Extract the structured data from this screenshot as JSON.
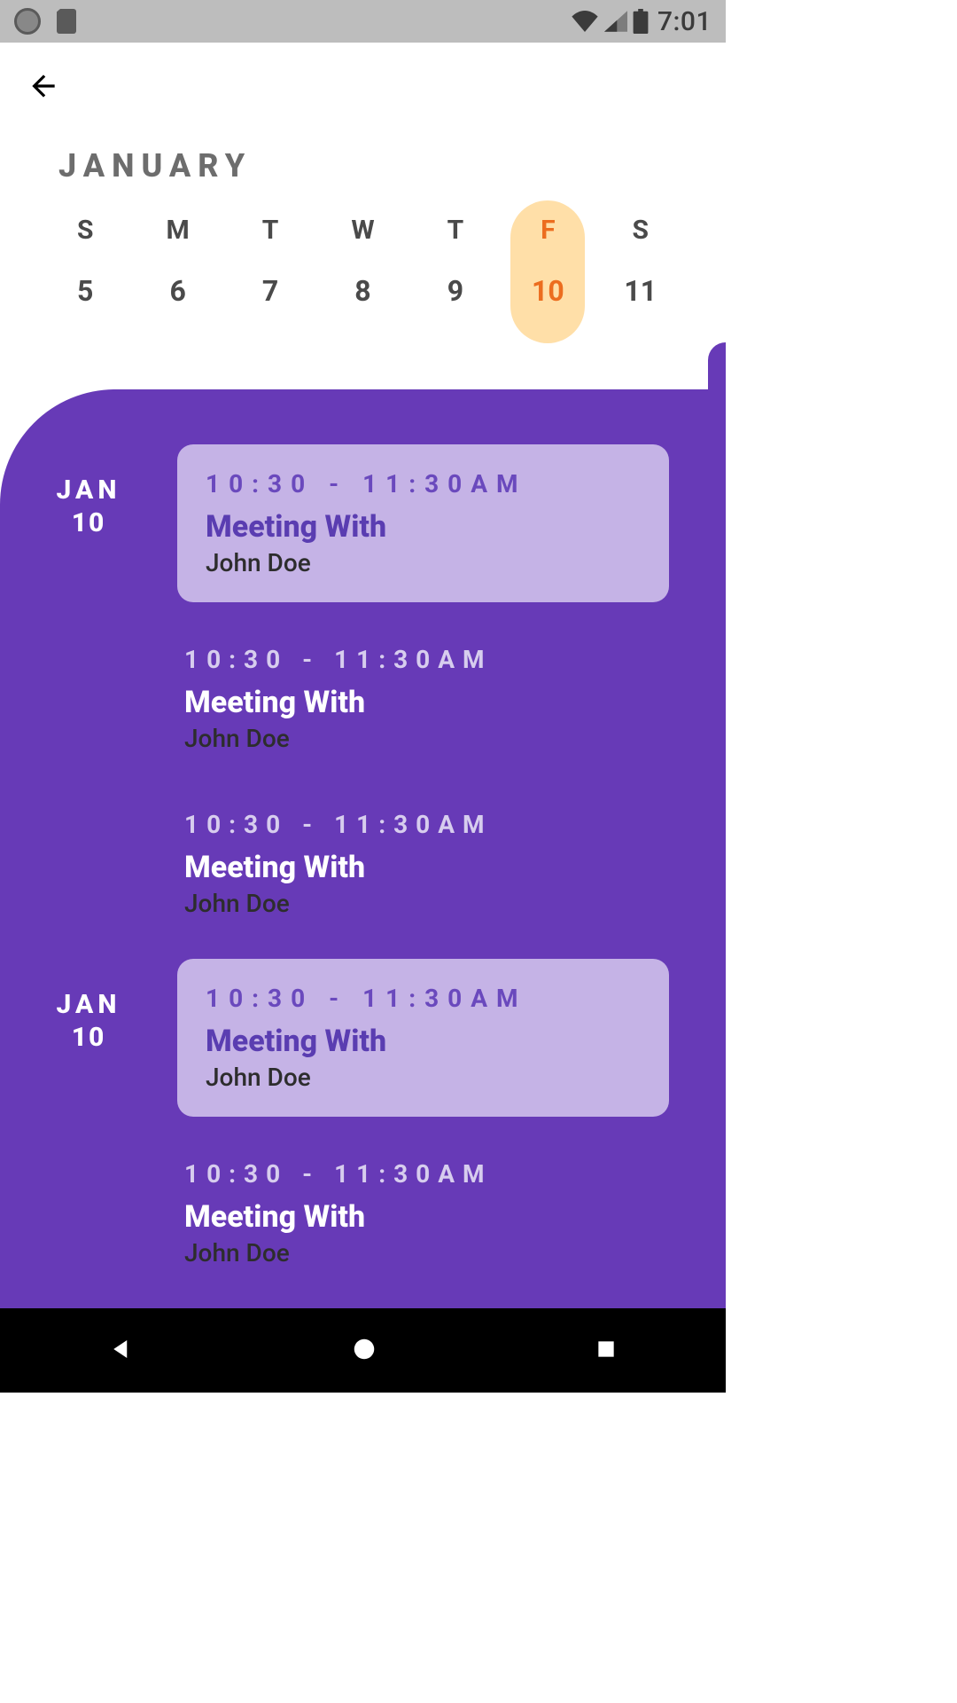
{
  "status": {
    "time": "7:01"
  },
  "month_title": "JANUARY",
  "week": [
    {
      "label": "S",
      "num": "5",
      "selected": false
    },
    {
      "label": "M",
      "num": "6",
      "selected": false
    },
    {
      "label": "T",
      "num": "7",
      "selected": false
    },
    {
      "label": "W",
      "num": "8",
      "selected": false
    },
    {
      "label": "T",
      "num": "9",
      "selected": false
    },
    {
      "label": "F",
      "num": "10",
      "selected": true
    },
    {
      "label": "S",
      "num": "11",
      "selected": false
    }
  ],
  "groups": [
    {
      "date_month": "JAN",
      "date_day": "10",
      "events": [
        {
          "time": "10:30 - 11:30AM",
          "title": "Meeting With",
          "person": "John Doe",
          "highlight": true
        },
        {
          "time": "10:30 - 11:30AM",
          "title": "Meeting With",
          "person": "John Doe",
          "highlight": false
        },
        {
          "time": "10:30 - 11:30AM",
          "title": "Meeting With",
          "person": "John Doe",
          "highlight": false
        }
      ]
    },
    {
      "date_month": "JAN",
      "date_day": "10",
      "events": [
        {
          "time": "10:30 - 11:30AM",
          "title": "Meeting With",
          "person": "John Doe",
          "highlight": true
        },
        {
          "time": "10:30 - 11:30AM",
          "title": "Meeting With",
          "person": "John Doe",
          "highlight": false
        }
      ]
    }
  ]
}
